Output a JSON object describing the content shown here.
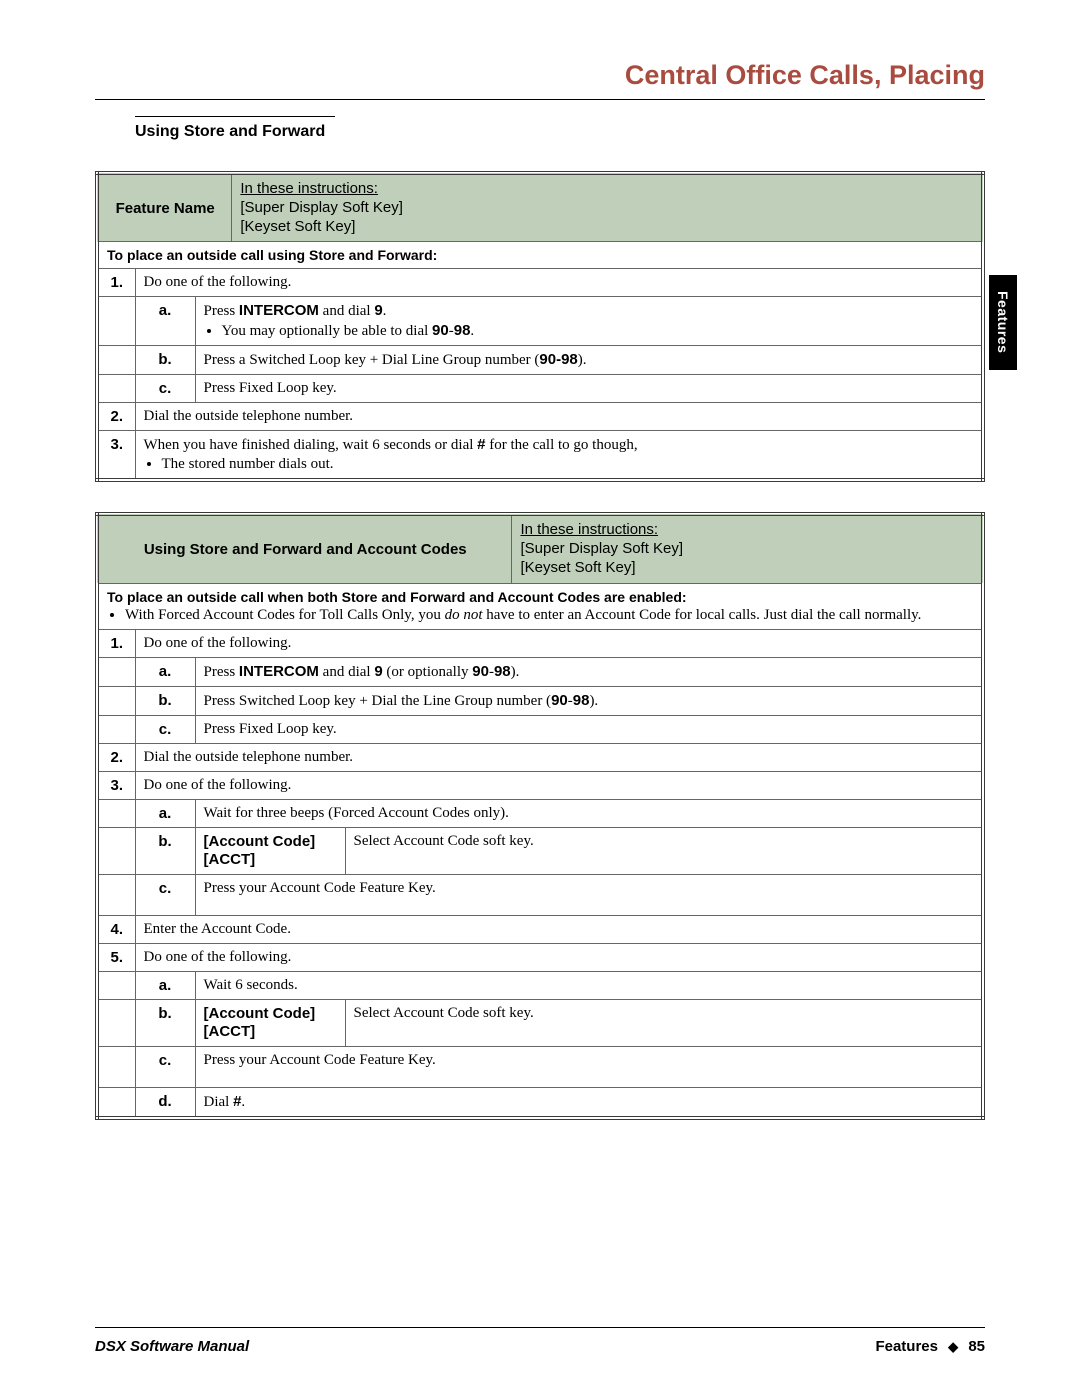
{
  "header": {
    "title": "Central Office Calls, Placing"
  },
  "sideTab": "Features",
  "section": {
    "title": "Using Store and Forward"
  },
  "legend": {
    "intro": "In these instructions:",
    "line1": "[Super Display Soft Key]",
    "line2": "[Keyset Soft Key]"
  },
  "table1": {
    "featureName": "Feature Name",
    "sub": "To place an outside call using Store and Forward:",
    "r1": {
      "num": "1.",
      "text": "Do one of the following."
    },
    "r1a": {
      "lett": "a.",
      "line": "Press INTERCOM and dial 9.",
      "bullet": "You may optionally be able to dial 90-98."
    },
    "r1b": {
      "lett": "b.",
      "text": "Press a Switched Loop key + Dial Line Group number (90-98)."
    },
    "r1c": {
      "lett": "c.",
      "text": "Press Fixed Loop key."
    },
    "r2": {
      "num": "2.",
      "text": "Dial the outside telephone number."
    },
    "r3": {
      "num": "3.",
      "text": "When you have finished dialing, wait 6 seconds or dial # for the call to go though,",
      "bullet": "The stored number dials out."
    }
  },
  "table2": {
    "featureName": "Using Store and Forward and Account Codes",
    "sub": "To place an outside call when both Store and Forward and Account Codes are enabled:",
    "subBullet": "With Forced Account Codes for Toll Calls Only, you do not have to enter an Account Code for local calls. Just dial the call normally.",
    "r1": {
      "num": "1.",
      "text": "Do one of the following."
    },
    "r1a": {
      "lett": "a.",
      "text": "Press INTERCOM and dial 9 (or optionally 90-98)."
    },
    "r1b": {
      "lett": "b.",
      "text": "Press Switched Loop key + Dial the Line Group number (90-98)."
    },
    "r1c": {
      "lett": "c.",
      "text": "Press Fixed Loop key."
    },
    "r2": {
      "num": "2.",
      "text": "Dial the outside telephone number."
    },
    "r3": {
      "num": "3.",
      "text": "Do one of the following."
    },
    "r3a": {
      "lett": "a.",
      "text": "Wait for three beeps (Forced Account Codes only)."
    },
    "r3b": {
      "lett": "b.",
      "sk1": "[Account Code]",
      "sk2": "[ACCT]",
      "text": "Select Account Code soft key."
    },
    "r3c": {
      "lett": "c.",
      "text": "Press your Account Code Feature Key."
    },
    "r4": {
      "num": "4.",
      "text": "Enter the Account Code."
    },
    "r5": {
      "num": "5.",
      "text": "Do one of the following."
    },
    "r5a": {
      "lett": "a.",
      "text": "Wait 6 seconds."
    },
    "r5b": {
      "lett": "b.",
      "sk1": "[Account Code]",
      "sk2": "[ACCT]",
      "text": "Select Account Code soft key."
    },
    "r5c": {
      "lett": "c.",
      "text": "Press your Account Code Feature Key."
    },
    "r5d": {
      "lett": "d.",
      "text": "Dial #."
    }
  },
  "footer": {
    "left": "DSX Software Manual",
    "rightLabel": "Features",
    "pageNum": "85"
  }
}
